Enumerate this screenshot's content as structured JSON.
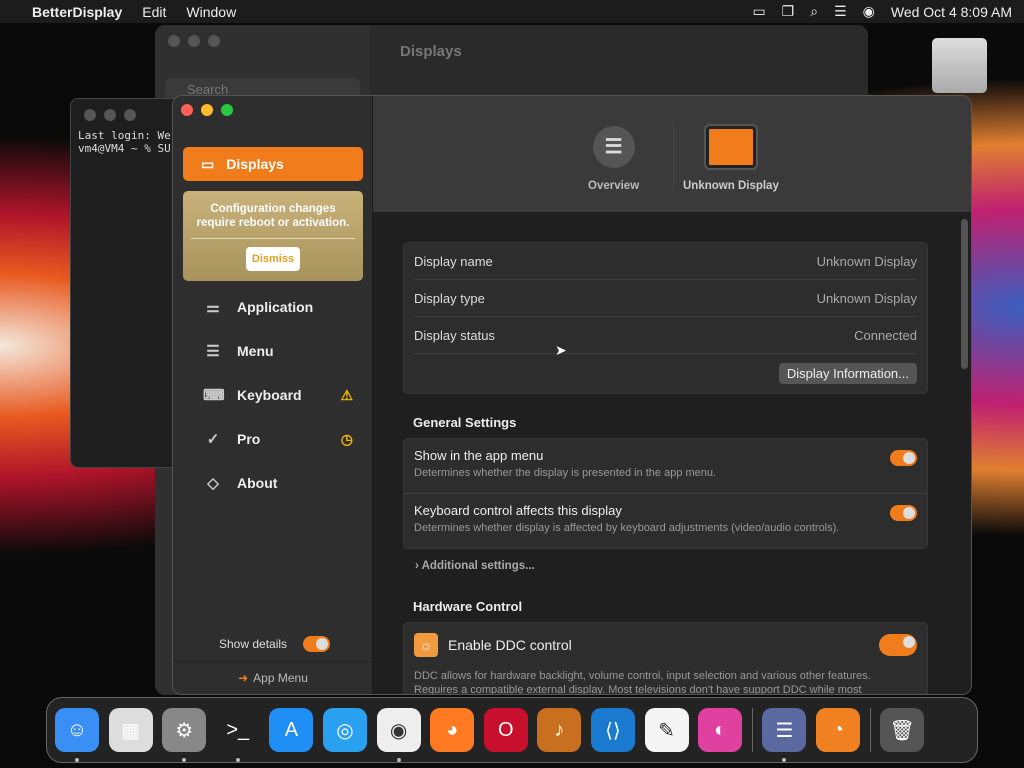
{
  "menubar": {
    "app": "BetterDisplay",
    "items": [
      "Edit",
      "Window"
    ],
    "clock": "Wed Oct 4  8:09 AM"
  },
  "bg_window": {
    "title": "Displays",
    "search_placeholder": "Search"
  },
  "terminal": {
    "text": "Last login: We\nvm4@VM4 ~ % SU"
  },
  "sidebar": {
    "selected": "Displays",
    "notice": "Configuration changes require reboot or activation.",
    "dismiss": "Dismiss",
    "items": [
      {
        "label": "Application",
        "icon": "toggles-icon"
      },
      {
        "label": "Menu",
        "icon": "menu-icon"
      },
      {
        "label": "Keyboard",
        "icon": "keyboard-icon",
        "badge": "⚠"
      },
      {
        "label": "Pro",
        "icon": "checkmark-seal-icon",
        "badge": "◷"
      },
      {
        "label": "About",
        "icon": "tag-icon"
      }
    ],
    "show_details": "Show details",
    "show_details_on": true,
    "app_menu": "App Menu"
  },
  "tabs": [
    {
      "label": "Overview"
    },
    {
      "label": "Unknown Display"
    }
  ],
  "info": {
    "rows": [
      {
        "k": "Display name",
        "v": "Unknown Display"
      },
      {
        "k": "Display type",
        "v": "Unknown Display"
      },
      {
        "k": "Display status",
        "v": "Connected"
      }
    ],
    "button": "Display Information..."
  },
  "general": {
    "title": "General Settings",
    "settings": [
      {
        "title": "Show in the app menu",
        "desc": "Determines whether the display is presented in the app menu.",
        "on": true
      },
      {
        "title": "Keyboard control affects this display",
        "desc": "Determines whether display is affected by keyboard adjustments (video/audio controls).",
        "on": true
      }
    ],
    "additional": "Additional settings..."
  },
  "hardware": {
    "title": "Hardware Control",
    "ddc": "Enable DDC control",
    "ddc_on": true,
    "desc1": "DDC allows for hardware backlight, volume control, input selection and various other features.",
    "desc2": "Requires a compatible external display. Most televisions don't have support DDC while most"
  },
  "accent": "#f07c1c",
  "dock": [
    "Finder",
    "Launchpad",
    "System Settings",
    "Terminal",
    "App Store",
    "Safari",
    "Chrome",
    "Firefox",
    "Opera",
    "GarageBand",
    "VS Code",
    "TextEdit",
    "Pixelmator",
    "BetterDisplay",
    "Blender",
    "Trash"
  ]
}
